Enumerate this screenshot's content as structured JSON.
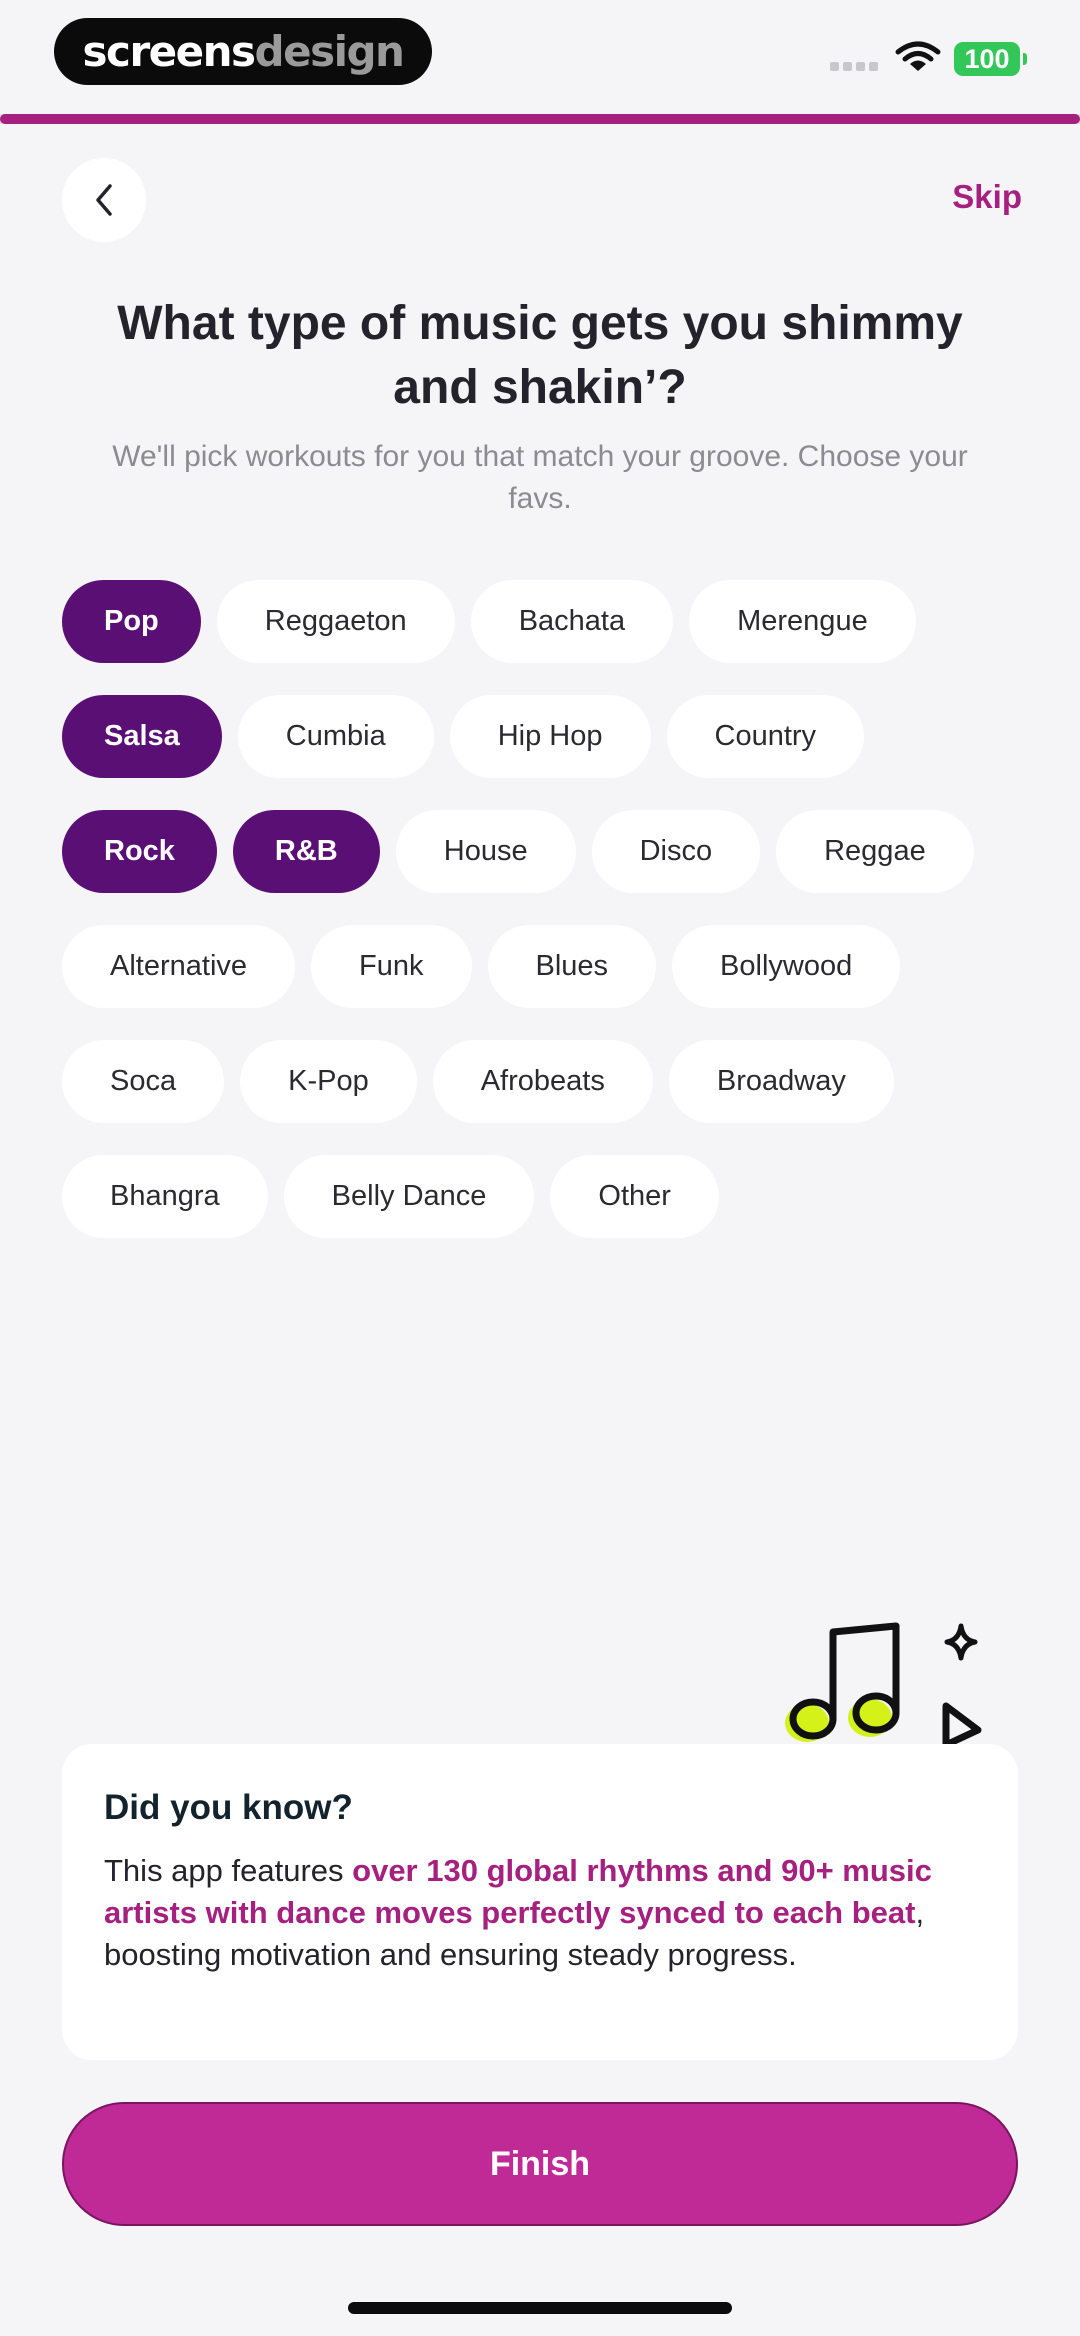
{
  "status_bar": {
    "brand_part1": "screens",
    "brand_part2": "design",
    "battery": "100"
  },
  "progress": {
    "fraction": 1.0,
    "color": "#a5207f"
  },
  "header": {
    "skip_label": "Skip",
    "back_icon": "chevron-left-icon"
  },
  "title": "What type of music gets you shimmy and shakin’?",
  "subtitle": "We'll pick workouts for you that match your groove. Choose your favs.",
  "genres": [
    {
      "label": "Pop",
      "selected": true
    },
    {
      "label": "Reggaeton",
      "selected": false
    },
    {
      "label": "Bachata",
      "selected": false
    },
    {
      "label": "Merengue",
      "selected": false
    },
    {
      "label": "Salsa",
      "selected": true
    },
    {
      "label": "Cumbia",
      "selected": false
    },
    {
      "label": "Hip Hop",
      "selected": false
    },
    {
      "label": "Country",
      "selected": false
    },
    {
      "label": "Rock",
      "selected": true
    },
    {
      "label": "R&B",
      "selected": true
    },
    {
      "label": "House",
      "selected": false
    },
    {
      "label": "Disco",
      "selected": false
    },
    {
      "label": "Reggae",
      "selected": false
    },
    {
      "label": "Alternative",
      "selected": false
    },
    {
      "label": "Funk",
      "selected": false
    },
    {
      "label": "Blues",
      "selected": false
    },
    {
      "label": "Bollywood",
      "selected": false
    },
    {
      "label": "Soca",
      "selected": false
    },
    {
      "label": "K-Pop",
      "selected": false
    },
    {
      "label": "Afrobeats",
      "selected": false
    },
    {
      "label": "Broadway",
      "selected": false
    },
    {
      "label": "Bhangra",
      "selected": false
    },
    {
      "label": "Belly Dance",
      "selected": false
    },
    {
      "label": "Other",
      "selected": false
    }
  ],
  "fact_card": {
    "title": "Did you know?",
    "body_prefix": "This app features ",
    "body_highlight": "over 130 global rhythms and 90+ music artists with dance moves perfectly synced to each beat",
    "body_suffix": ", boosting motivation and ensuring steady progress.",
    "illustration": "music-notes-icon"
  },
  "finish_label": "Finish",
  "colors": {
    "accent": "#a5207f",
    "chip_selected": "#5a0f74",
    "finish_button": "#c02a96",
    "note_highlight": "#d4f21a"
  }
}
